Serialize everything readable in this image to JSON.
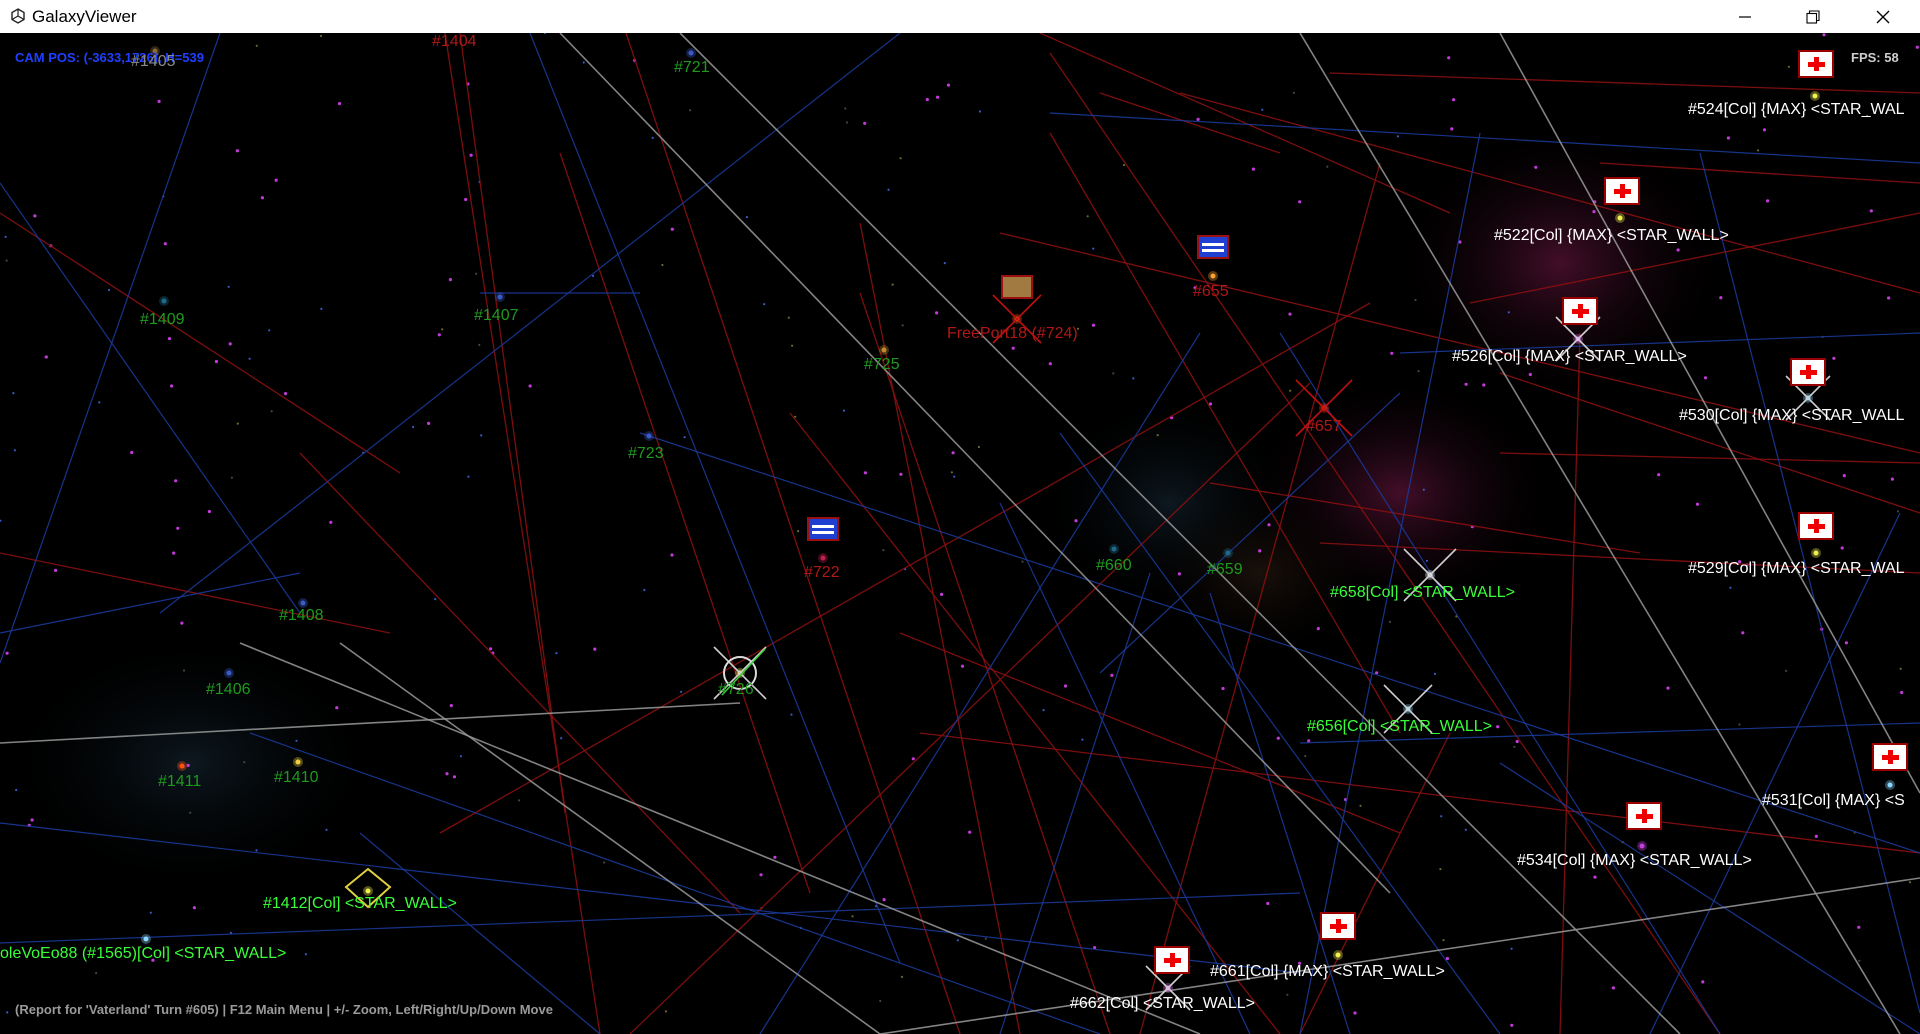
{
  "window": {
    "title": "GalaxyViewer",
    "icon": "unity-icon",
    "minimize_icon": "minimize-icon",
    "maximize_icon": "restore-icon",
    "close_icon": "close-icon"
  },
  "hud": {
    "cam_pos": "CAM POS: (-3633,1726), H=539",
    "fps": "FPS: 58",
    "status": "(Report for 'Vaterland' Turn #605) | F12 Main Menu | +/- Zoom, Left/Right/Up/Down Move"
  },
  "systems": [
    {
      "label": "#1404",
      "color": "r"
    },
    {
      "label": "#1405",
      "color": "gy"
    },
    {
      "label": "#721",
      "color": "g"
    },
    {
      "label": "#1409",
      "color": "g"
    },
    {
      "label": "#1407",
      "color": "g"
    },
    {
      "label": "#725",
      "color": "g"
    },
    {
      "label": "FreePort18 (#724)",
      "color": "r"
    },
    {
      "label": "#655",
      "color": "r"
    },
    {
      "label": "#657",
      "color": "r"
    },
    {
      "label": "#723",
      "color": "g"
    },
    {
      "label": "#722",
      "color": "r"
    },
    {
      "label": "#660",
      "color": "g"
    },
    {
      "label": "#659",
      "color": "g"
    },
    {
      "label": "#1408",
      "color": "g"
    },
    {
      "label": "#726",
      "color": "g"
    },
    {
      "label": "#1406",
      "color": "g"
    },
    {
      "label": "#1411",
      "color": "g"
    },
    {
      "label": "#1410",
      "color": "g"
    },
    {
      "label": "#524[Col] {MAX} <STAR_WAL",
      "color": "w"
    },
    {
      "label": "#522[Col] {MAX} <STAR_WALL>",
      "color": "w"
    },
    {
      "label": "#526[Col] {MAX} <STAR_WALL>",
      "color": "w"
    },
    {
      "label": "#530[Col] {MAX} <STAR_WALL",
      "color": "w"
    },
    {
      "label": "#529[Col] {MAX} <STAR_WAL",
      "color": "w"
    },
    {
      "label": "#658[Col] <STAR_WALL>",
      "color": "bg"
    },
    {
      "label": "#656[Col] <STAR_WALL>",
      "color": "bg"
    },
    {
      "label": "#531[Col] {MAX} <S",
      "color": "w"
    },
    {
      "label": "#534[Col] {MAX} <STAR_WALL>",
      "color": "w"
    },
    {
      "label": "#1412[Col] <STAR_WALL>",
      "color": "bg"
    },
    {
      "label": "oleVoEo88 (#1565)[Col] <STAR_WALL>",
      "color": "bg"
    },
    {
      "label": "#661[Col] {MAX} <STAR_WALL>",
      "color": "w"
    },
    {
      "label": "#662[Col] <STAR_WALL>",
      "color": "w"
    }
  ],
  "flags": [
    {
      "kind": "cross",
      "name": "flag-icon-524"
    },
    {
      "kind": "cross",
      "name": "flag-icon-522"
    },
    {
      "kind": "cross",
      "name": "flag-icon-526"
    },
    {
      "kind": "cross",
      "name": "flag-icon-530"
    },
    {
      "kind": "cross",
      "name": "flag-icon-529"
    },
    {
      "kind": "cross",
      "name": "flag-icon-531"
    },
    {
      "kind": "cross",
      "name": "flag-icon-534"
    },
    {
      "kind": "cross",
      "name": "flag-icon-661"
    },
    {
      "kind": "cross",
      "name": "flag-icon-662"
    },
    {
      "kind": "blue",
      "name": "flag-icon-655"
    },
    {
      "kind": "blue",
      "name": "flag-icon-722"
    },
    {
      "kind": "brown",
      "name": "flag-icon-724"
    }
  ],
  "colors": {
    "lane_red": "#8a1010",
    "lane_blue": "#1a3a9a",
    "lane_gray": "#9a9a9a",
    "label_green": "#1f9a1f",
    "label_bright_green": "#39ff39",
    "hud_blue": "#1f3fff"
  }
}
